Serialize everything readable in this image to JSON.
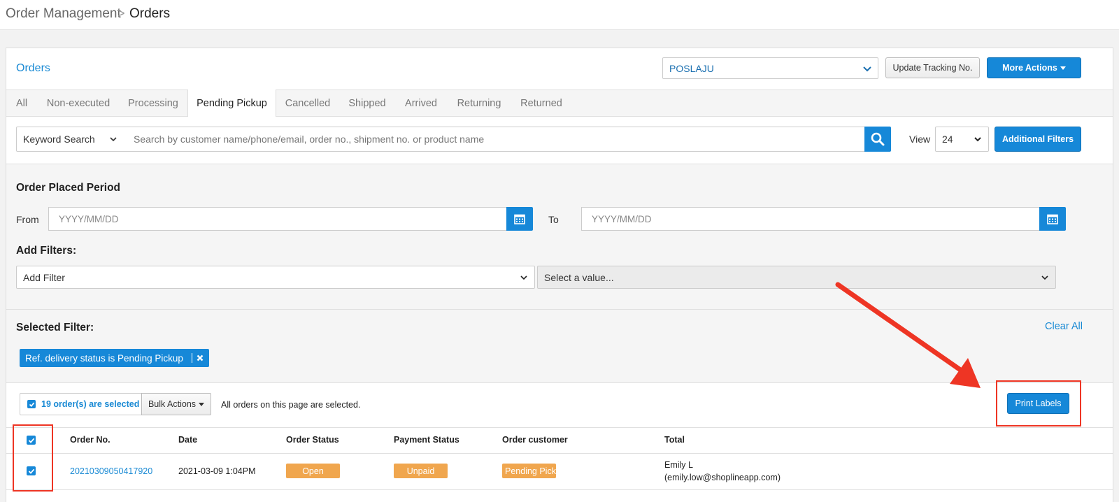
{
  "breadcrumb": {
    "parent": "Order Management",
    "separator": ">",
    "current": "Orders"
  },
  "header": {
    "title": "Orders",
    "courier_select": "POSLAJU",
    "update_tracking_label": "Update Tracking No.",
    "more_actions_label": "More Actions"
  },
  "tabs": [
    {
      "label": "All"
    },
    {
      "label": "Non-executed"
    },
    {
      "label": "Processing"
    },
    {
      "label": "Pending Pickup",
      "active": true
    },
    {
      "label": "Cancelled"
    },
    {
      "label": "Shipped"
    },
    {
      "label": "Arrived"
    },
    {
      "label": "Returning"
    },
    {
      "label": "Returned"
    }
  ],
  "search": {
    "type_select": "Keyword Search",
    "placeholder": "Search by customer name/phone/email, order no., shipment no. or product name",
    "view_label": "View",
    "view_value": "24",
    "additional_filters_label": "Additional Filters"
  },
  "period": {
    "title": "Order Placed Period",
    "from_label": "From",
    "from_placeholder": "YYYY/MM/DD",
    "to_label": "To",
    "to_placeholder": "YYYY/MM/DD"
  },
  "add_filters": {
    "title": "Add Filters:",
    "filter_select": "Add Filter",
    "value_select": "Select a value..."
  },
  "selected_filter": {
    "title": "Selected Filter:",
    "clear_all_label": "Clear All",
    "chip_label": "Ref. delivery status is Pending Pickup"
  },
  "bulk": {
    "selected_label": "19 order(s) are selected",
    "bulk_actions_label": "Bulk Actions",
    "all_selected_text": "All orders on this page are selected.",
    "print_labels_label": "Print Labels"
  },
  "table": {
    "columns": [
      "Order No.",
      "Date",
      "Order Status",
      "Payment Status",
      "Order customer",
      "Total"
    ],
    "rows": [
      {
        "order_no": "20210309050417920",
        "date": "2021-03-09 1:04PM",
        "order_status": "Open",
        "payment_status": "Unpaid",
        "delivery_status": "Pending Picku",
        "customer_name": "Emily L",
        "customer_email": "(emily.low@shoplineapp.com)"
      }
    ]
  },
  "colors": {
    "accent": "#1688d8",
    "status_orange": "#f0a64e",
    "annotation_red": "#ee3524"
  }
}
